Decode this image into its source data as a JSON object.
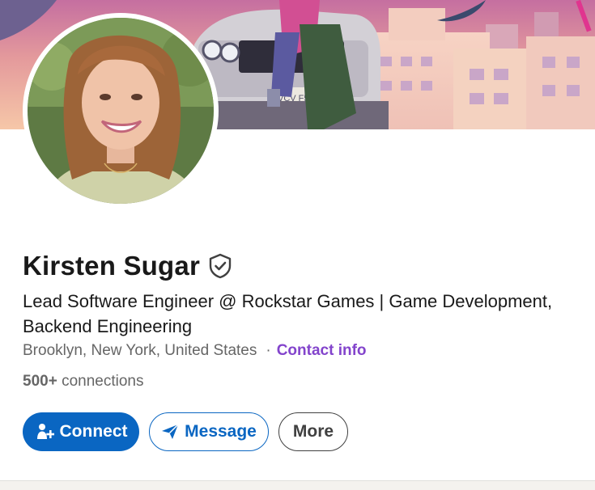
{
  "profile": {
    "name": "Kirsten Sugar",
    "headline_line1": "Lead Software Engineer @ Rockstar Games | Game Development,",
    "headline_line2": "Backend Engineering",
    "location": "Brooklyn, New York, United States",
    "separator": "·",
    "contact_label": "Contact info",
    "connections_count": "500+",
    "connections_label": "connections"
  },
  "actions": {
    "connect_label": "Connect",
    "message_label": "Message",
    "more_label": "More"
  },
  "banner": {
    "license_plate": "VCV F5"
  },
  "colors": {
    "primary": "#0a66c2",
    "contact_link": "#8344cc",
    "text": "#191919",
    "muted": "#666666"
  },
  "icons": {
    "verified": "verified-shield-icon",
    "connect": "add-person-icon",
    "message": "send-icon"
  }
}
